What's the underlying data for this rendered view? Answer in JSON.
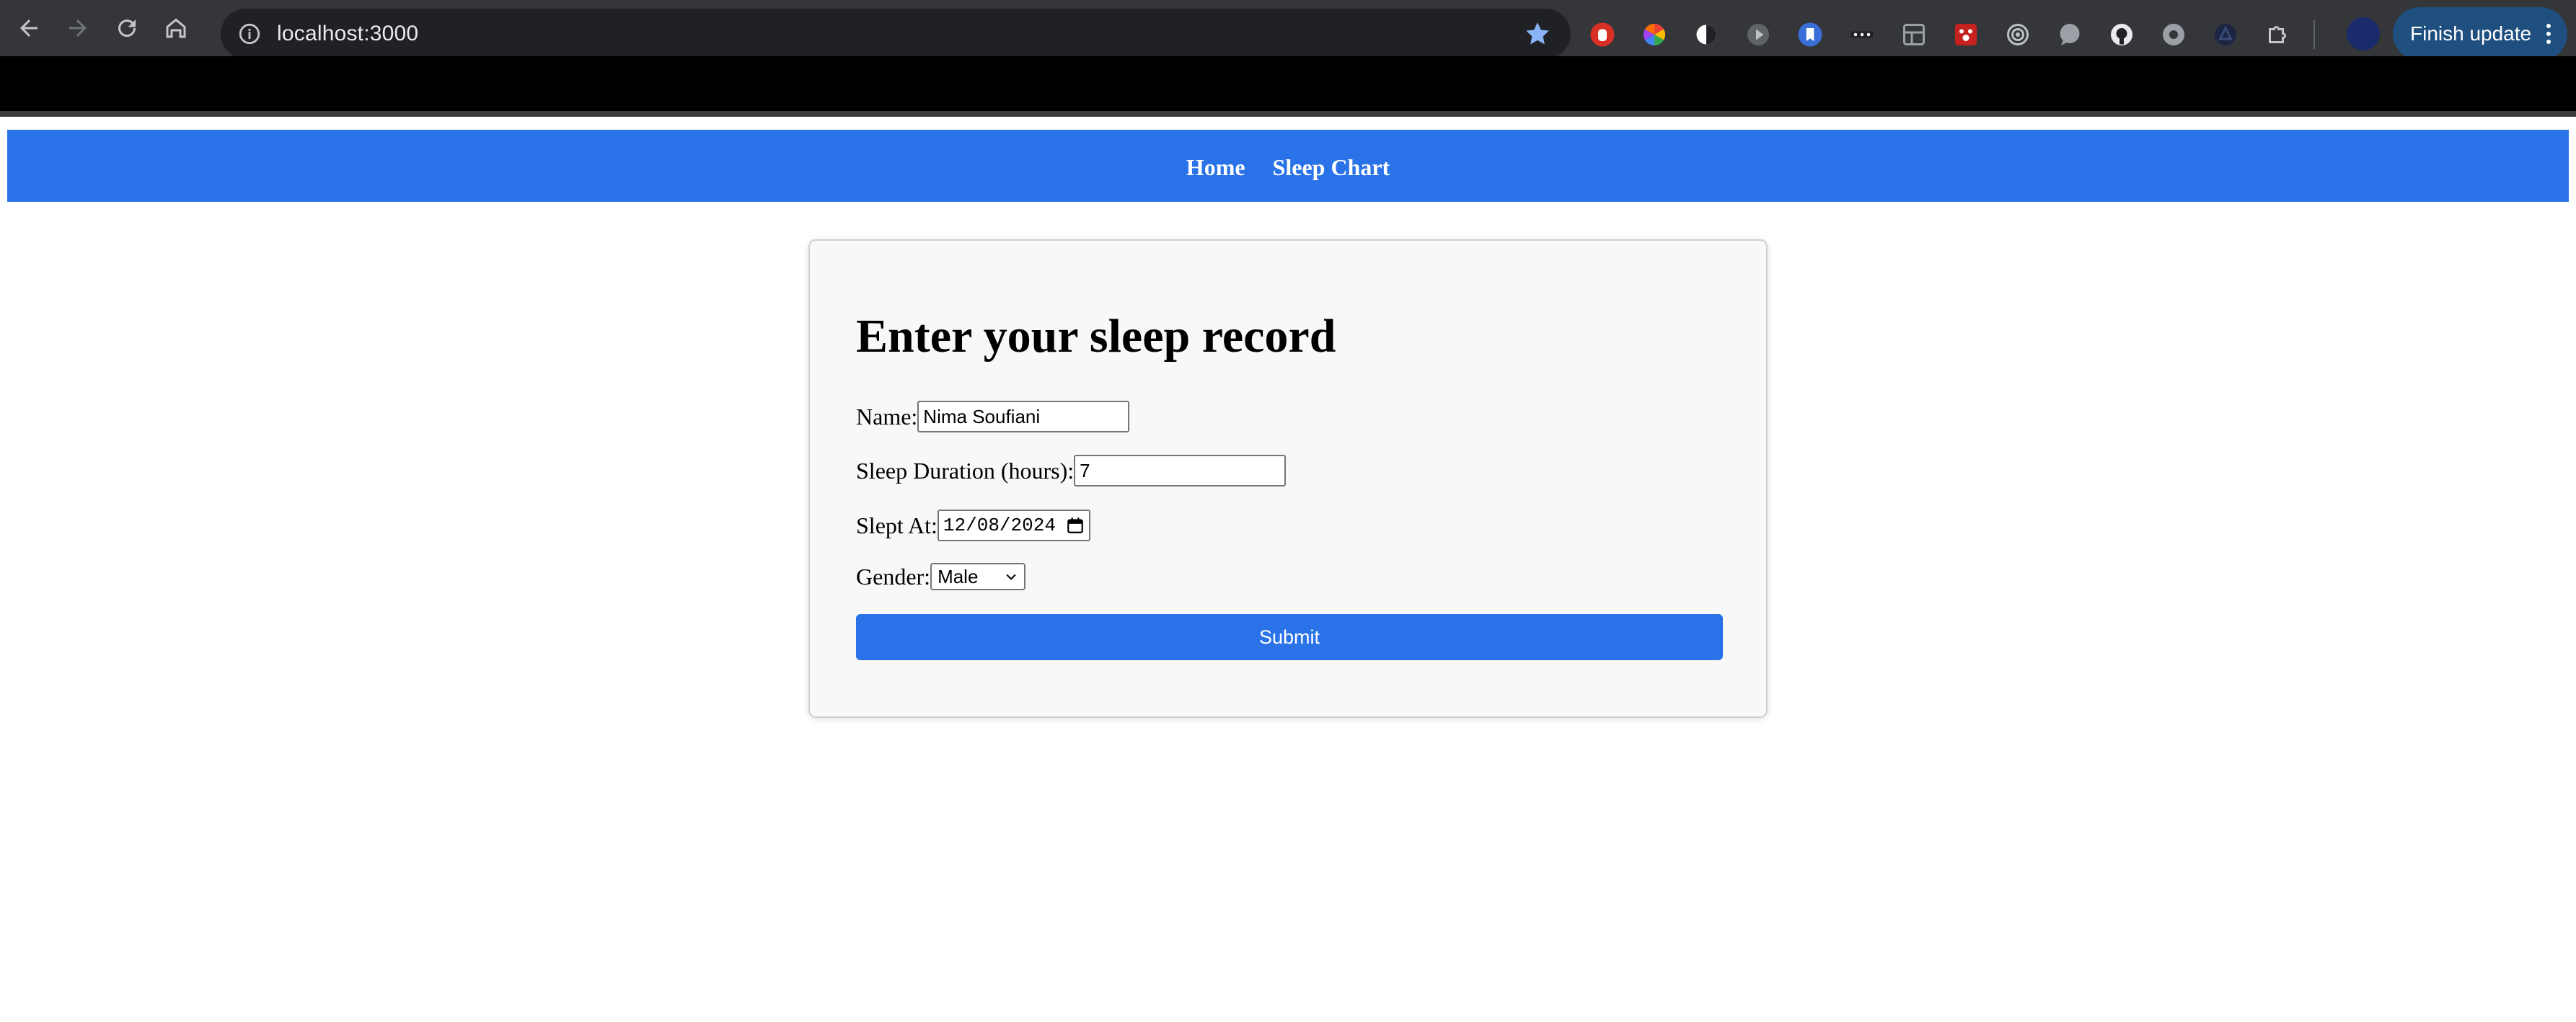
{
  "browser": {
    "url": "localhost:3000",
    "finish_update_label": "Finish update",
    "extensions": [
      "stop-hand-icon",
      "color-wheel-icon",
      "half-circle-icon",
      "play-icon",
      "bookmark-ext-icon",
      "dots-ext-icon",
      "image-ext-icon",
      "paw-ext-icon",
      "target-icon",
      "chat-bubble-icon",
      "github-icon",
      "gear-ext-icon",
      "triangle-ext-icon",
      "puzzle-icon"
    ]
  },
  "nav": {
    "home_label": "Home",
    "sleep_chart_label": "Sleep Chart"
  },
  "form": {
    "title": "Enter your sleep record",
    "name_label": "Name:",
    "name_value": "Nima Soufiani",
    "duration_label": "Sleep Duration (hours):",
    "duration_value": "7",
    "slept_at_label": "Slept At:",
    "slept_at_value": "12/08/2024",
    "gender_label": "Gender:",
    "gender_value": "Male",
    "submit_label": "Submit"
  },
  "colors": {
    "accent": "#2a72e8",
    "chrome_bg": "#35363a",
    "omnibox_bg": "#202124",
    "update_pill": "#1f4f7f"
  }
}
